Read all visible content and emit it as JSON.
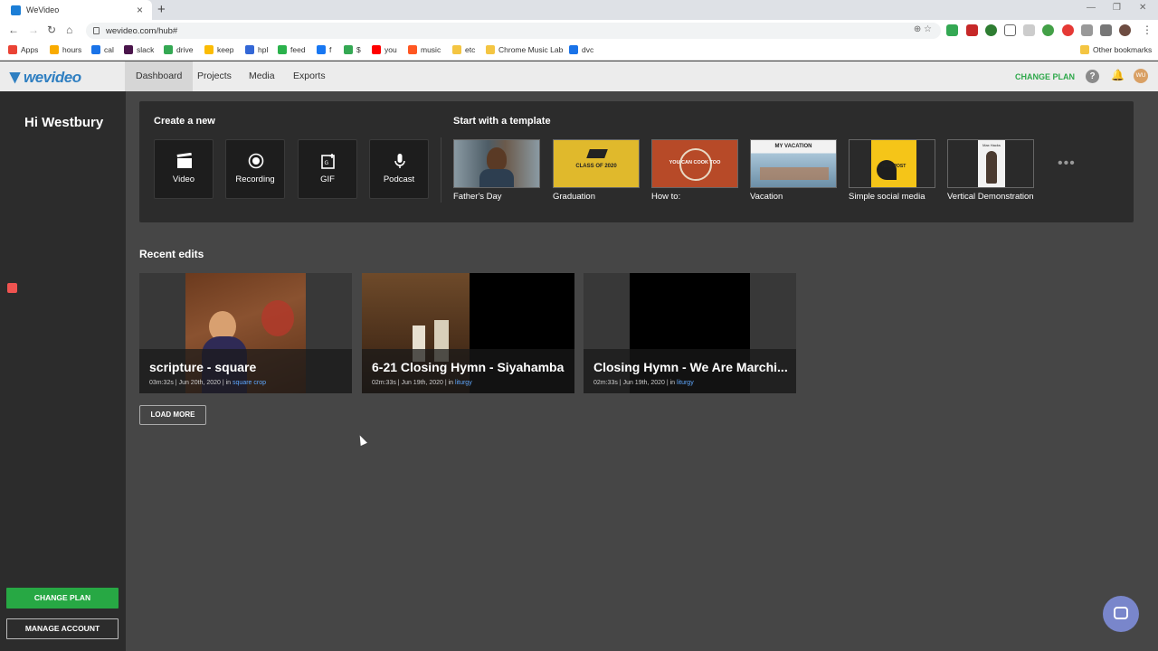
{
  "browser": {
    "tab_title": "WeVideo",
    "url": "wevideo.com/hub#",
    "bookmarks": [
      {
        "label": "Apps",
        "color": "#ea4335"
      },
      {
        "label": "hours",
        "color": "#f9ab00"
      },
      {
        "label": "cal",
        "color": "#1a73e8"
      },
      {
        "label": "slack",
        "color": "#4a154b"
      },
      {
        "label": "drive",
        "color": "#34a853"
      },
      {
        "label": "keep",
        "color": "#fbbc04"
      },
      {
        "label": "hpl",
        "color": "#3367d6"
      },
      {
        "label": "feed",
        "color": "#2bb24c"
      },
      {
        "label": "f",
        "color": "#1877f2"
      },
      {
        "label": "$",
        "color": "#34a853"
      },
      {
        "label": "you",
        "color": "#ff0000"
      },
      {
        "label": "music",
        "color": "#ff5722"
      },
      {
        "label": "etc",
        "color": "#f4c542"
      },
      {
        "label": "Chrome Music Lab",
        "color": "#f4c542"
      },
      {
        "label": "dvc",
        "color": "#1a73e8"
      }
    ],
    "other_bookmarks": "Other bookmarks"
  },
  "header": {
    "logo": "wevideo",
    "nav": [
      "Dashboard",
      "Projects",
      "Media",
      "Exports"
    ],
    "active_nav": "Dashboard",
    "change_plan": "CHANGE PLAN",
    "help": "?",
    "avatar_initials": "WU",
    "accent_color": "#2ea84a"
  },
  "sidebar": {
    "greeting": "Hi Westbury",
    "change_plan": "CHANGE PLAN",
    "manage_account": "MANAGE ACCOUNT"
  },
  "create": {
    "title": "Create a new",
    "items": [
      {
        "label": "Video",
        "icon": "clapperboard-icon"
      },
      {
        "label": "Recording",
        "icon": "record-icon"
      },
      {
        "label": "GIF",
        "icon": "gif-icon"
      },
      {
        "label": "Podcast",
        "icon": "microphone-icon"
      }
    ]
  },
  "templates": {
    "title": "Start with a template",
    "items": [
      {
        "label": "Father's Day",
        "bg": "#5b6e78"
      },
      {
        "label": "Graduation",
        "bg": "#e0b92c",
        "text": "CLASS OF 2020"
      },
      {
        "label": "How to:",
        "bg": "#b74a28",
        "text": "YOU CAN COOK TOO"
      },
      {
        "label": "Vacation",
        "bg": "#8db4cf",
        "text": "MY VACATION"
      },
      {
        "label": "Simple social media",
        "bg": "#f5c518",
        "text": "NEW POST"
      },
      {
        "label": "Vertical Demonstration",
        "bg": "#f2f2f2",
        "text": "Max Hacks"
      }
    ]
  },
  "recent": {
    "title": "Recent edits",
    "cards": [
      {
        "title": "scripture - square",
        "duration": "03m:32s",
        "date": "Jun 20th, 2020",
        "in": "in",
        "folder": "square crop"
      },
      {
        "title": "6-21 Closing Hymn - Siyahamba",
        "duration": "02m:33s",
        "date": "Jun 19th, 2020",
        "in": "in",
        "folder": "liturgy"
      },
      {
        "title": "Closing Hymn - We Are Marchi...",
        "duration": "02m:33s",
        "date": "Jun 19th, 2020",
        "in": "in",
        "folder": "liturgy"
      }
    ],
    "load_more": "LOAD MORE"
  }
}
